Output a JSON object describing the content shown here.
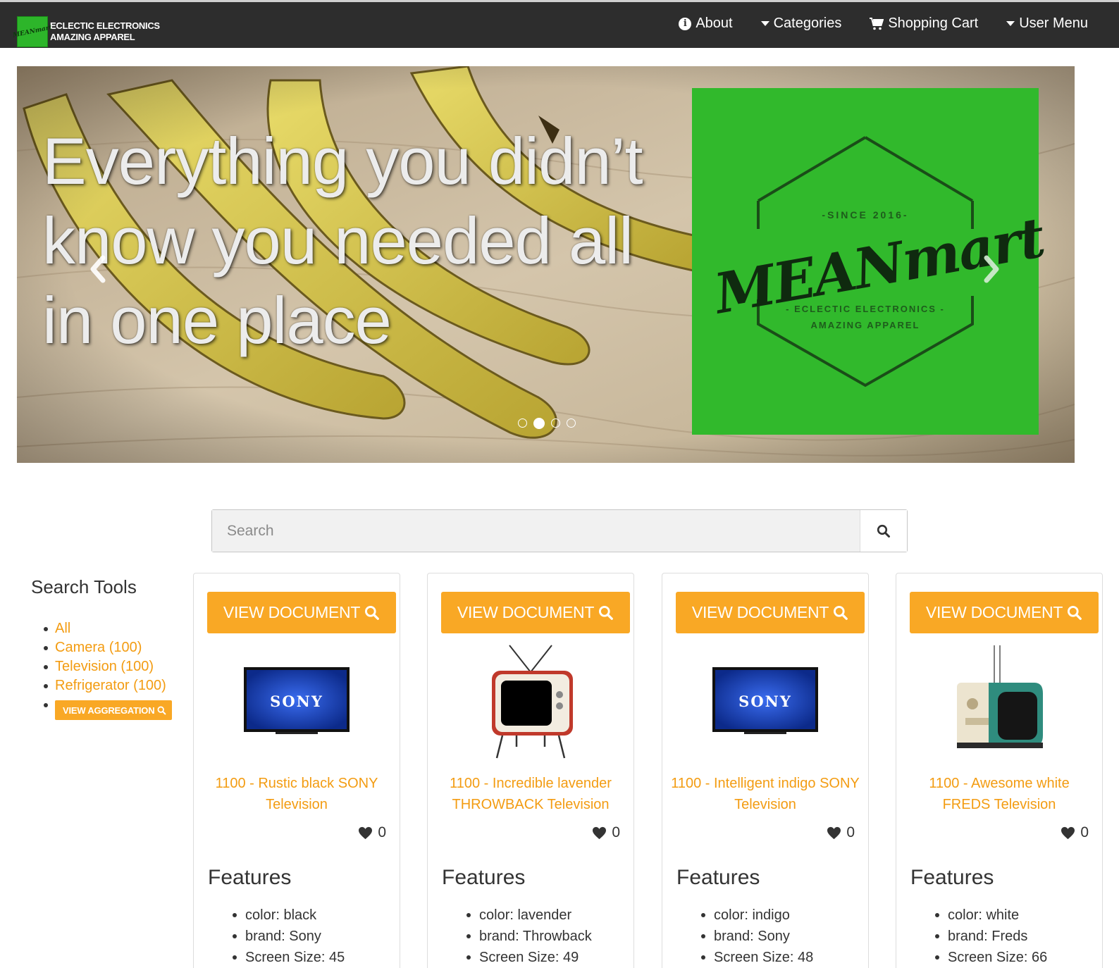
{
  "brand": {
    "logo_text": "MEANmart",
    "line1": "ECLECTIC ELECTRONICS",
    "line2": "AMAZING APPAREL"
  },
  "nav": [
    {
      "label": "About",
      "icon": "info-circle-icon"
    },
    {
      "label": "Categories",
      "icon": "caret-down-icon"
    },
    {
      "label": "Shopping Cart",
      "icon": "shopping-cart-icon"
    },
    {
      "label": "User Menu",
      "icon": "caret-down-icon"
    }
  ],
  "hero": {
    "headline": "Everything you didn’t know you needed all in one place",
    "promo": {
      "since": "-SINCE 2016-",
      "name": "MEANmart",
      "tag1": "- ECLECTIC ELECTRONICS -",
      "tag2": "AMAZING APPAREL"
    },
    "slide_count": 4,
    "active_slide": 2
  },
  "search": {
    "placeholder": "Search",
    "value": ""
  },
  "sidebar": {
    "title": "Search Tools",
    "items": [
      {
        "label": "All"
      },
      {
        "label": "Camera (100)"
      },
      {
        "label": "Television (100)"
      },
      {
        "label": "Refrigerator (100)"
      }
    ],
    "aggregation_button": "VIEW AGGREGATION"
  },
  "products": [
    {
      "button": "VIEW DOCUMENT",
      "title": "1100 - Rustic black SONY Television",
      "likes": "0",
      "features_title": "Features",
      "features": [
        "color: black",
        "brand: Sony",
        "Screen Size: 45"
      ],
      "image": "sony-tv"
    },
    {
      "button": "VIEW DOCUMENT",
      "title": "1100 - Incredible lavender THROWBACK Television",
      "likes": "0",
      "features_title": "Features",
      "features": [
        "color: lavender",
        "brand: Throwback",
        "Screen Size: 49"
      ],
      "image": "retro-tv"
    },
    {
      "button": "VIEW DOCUMENT",
      "title": "1100 - Intelligent indigo SONY Television",
      "likes": "0",
      "features_title": "Features",
      "features": [
        "color: indigo",
        "brand: Sony",
        "Screen Size: 48"
      ],
      "image": "sony-tv"
    },
    {
      "button": "VIEW DOCUMENT",
      "title": "1100 - Awesome white FREDS Television",
      "likes": "0",
      "features_title": "Features",
      "features": [
        "color: white",
        "brand: Freds",
        "Screen Size: 66"
      ],
      "image": "vintage-tv"
    }
  ],
  "tv_brand_text": "SONY",
  "colors": {
    "accent": "#f9a825",
    "link": "#f39c12",
    "navbar": "#2d2d2d",
    "promo_green": "#31b92c"
  }
}
